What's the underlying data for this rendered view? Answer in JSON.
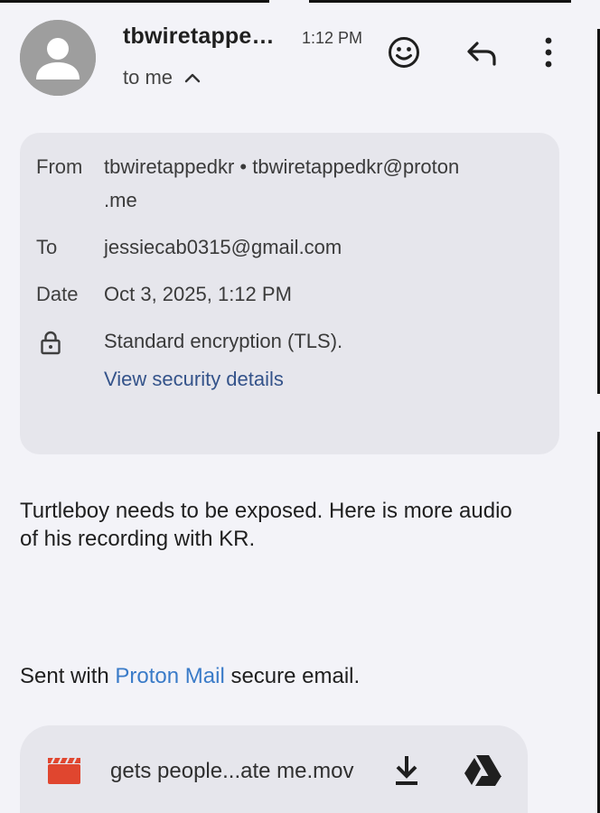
{
  "header": {
    "sender_display": "tbwiretappe…",
    "time": "1:12 PM",
    "recipient_summary": "to me",
    "icons": {
      "avatar": "person-avatar-icon",
      "emoji": "smiley-face-icon",
      "reply": "reply-arrow-icon",
      "more": "more-vert-icon",
      "collapse": "chevron-up-icon"
    }
  },
  "details": {
    "from_label": "From",
    "from_value_line1": "tbwiretappedkr • tbwiretappedkr@proton",
    "from_value_line2": ".me",
    "to_label": "To",
    "to_value": "jessiecab0315@gmail.com",
    "date_label": "Date",
    "date_value": "Oct 3, 2025, 1:12 PM",
    "encryption_value": "Standard encryption (TLS).",
    "security_link": "View security details",
    "lock_icon": "lock-icon"
  },
  "message": {
    "body": "Turtleboy needs to be exposed. Here is more audio of his recording with KR.",
    "sent_prefix": "Sent with ",
    "sent_link": "Proton Mail",
    "sent_suffix": " secure email."
  },
  "attachment": {
    "file_name": "gets people...ate me.mov",
    "icons": {
      "type": "video-clapperboard-icon",
      "download": "download-icon",
      "drive": "google-drive-icon"
    }
  },
  "colors": {
    "background": "#f3f3f8",
    "card": "#e6e6ec",
    "link_blue": "#3a7bc8",
    "video_red": "#e0462f",
    "avatar_gray": "#9e9e9e"
  }
}
